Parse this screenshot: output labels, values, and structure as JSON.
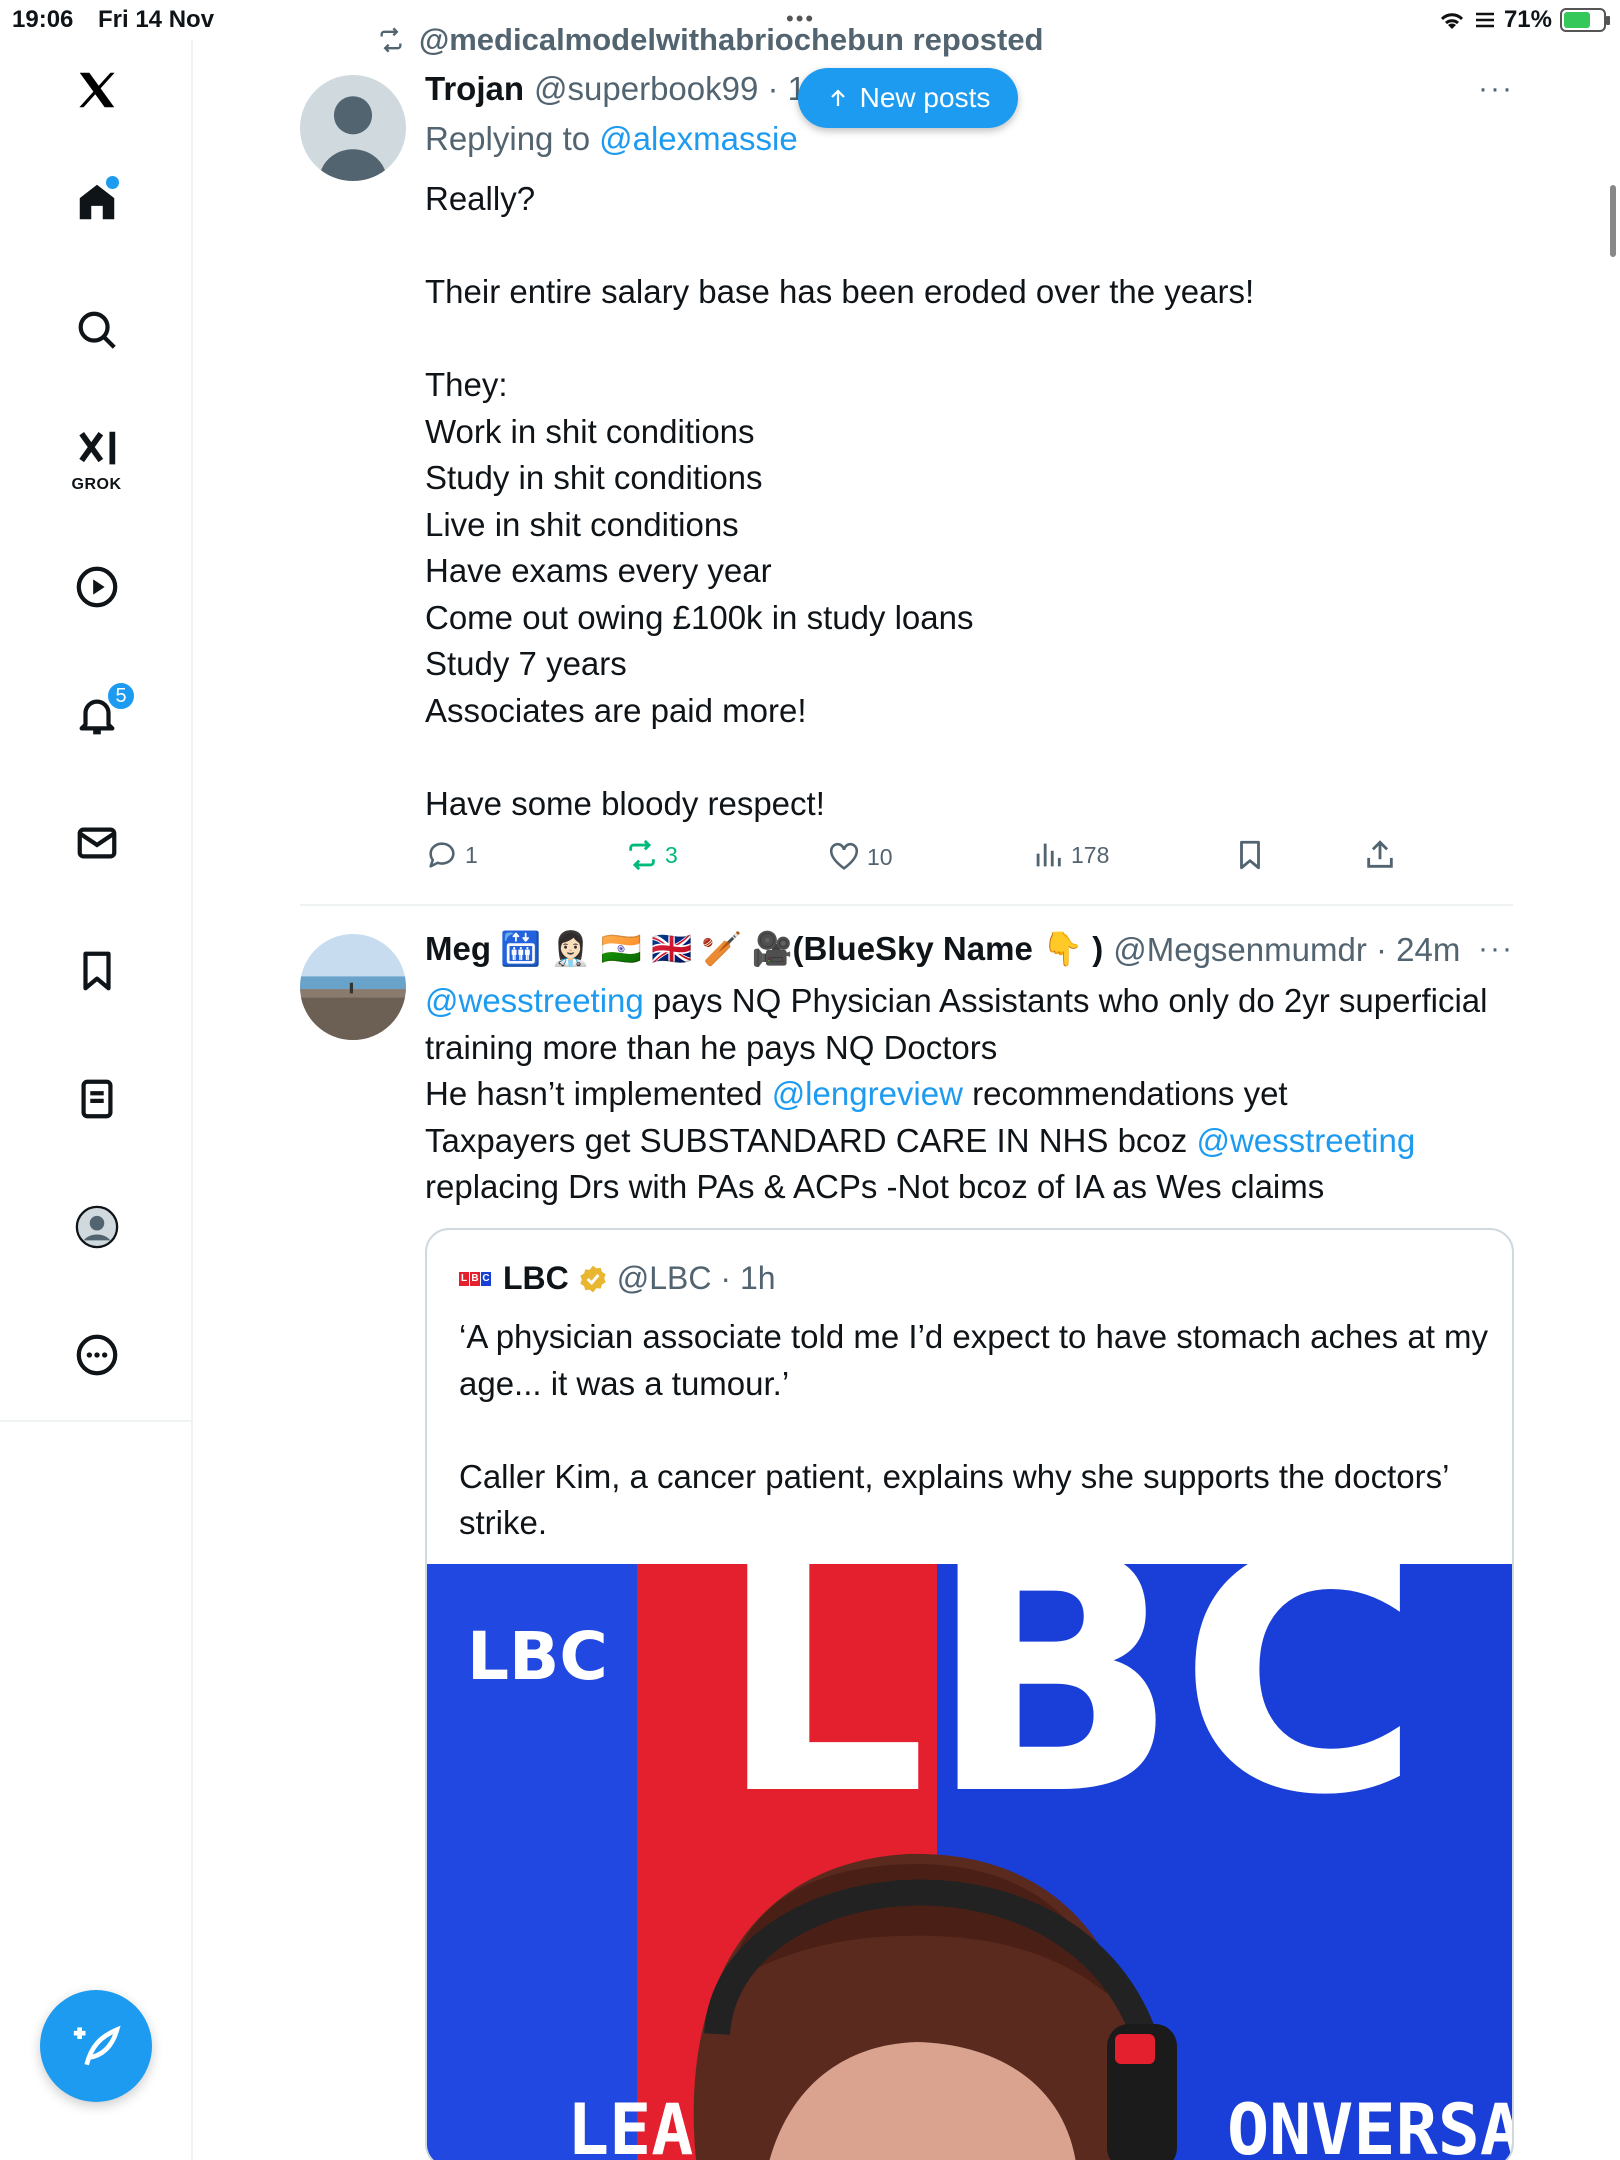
{
  "status_bar": {
    "time": "19:06",
    "date": "Fri 14 Nov",
    "battery": "71%",
    "battery_level": 0.71
  },
  "sidebar": {
    "items": [
      {
        "name": "x-logo"
      },
      {
        "name": "home",
        "has_dot": true
      },
      {
        "name": "search"
      },
      {
        "name": "grok",
        "label": "GROK"
      },
      {
        "name": "video"
      },
      {
        "name": "notifications",
        "badge": "5"
      },
      {
        "name": "messages"
      },
      {
        "name": "bookmarks"
      },
      {
        "name": "lists"
      },
      {
        "name": "profile"
      },
      {
        "name": "more"
      }
    ]
  },
  "new_posts_label": "New posts",
  "tweet1": {
    "repost_by": "@medicalmodelwithabriochebun reposted",
    "name": "Trojan",
    "handle": "@superbook99 · 1",
    "replying_label": "Replying to",
    "replying_to": "@alexmassie",
    "text": "Really?\n\nTheir entire salary base has been eroded over the years!\n\nThey:\nWork in shit conditions\nStudy in shit conditions\nLive in shit conditions\nHave exams every year\nCome out owing £100k in study loans\nStudy 7 years\nAssociates are paid more!\n\nHave some bloody respect!",
    "replies": "1",
    "reposts": "3",
    "likes": "10",
    "views": "178"
  },
  "tweet2": {
    "name": "Meg 🛗 👩🏻‍⚕️ 🇮🇳 🇬🇧 🏏 🎥(BlueSky Name 👇 )",
    "handle": "@Megsenmumdr · 24m",
    "text_parts": {
      "m1": "@wesstreeting",
      "t1": " pays NQ Physician Assistants who only do 2yr superficial training more than he pays NQ Doctors\nHe hasn’t implemented ",
      "m2": "@lengreview",
      "t2": " recommendations yet\nTaxpayers get SUBSTANDARD CARE IN NHS bcoz ",
      "m3": "@wesstreeting",
      "t3": "\nreplacing Drs with PAs & ACPs -Not bcoz of IA as Wes claims"
    },
    "quote": {
      "logo_text": "LBC",
      "name": "LBC",
      "handle": "@LBC · 1h",
      "text": "‘A physician associate told me I’d expect to have stomach aches at my age... it was a tumour.’\n\nCaller Kim, a cancer patient, explains why she supports the doctors’ strike.",
      "media_logo": "LBC",
      "media_big_letters": "LBC",
      "media_bottom_left": "LEA",
      "media_bottom_right": "ONVERSA"
    }
  },
  "colors": {
    "accent": "#1d9bf0",
    "repost_green": "#00ba7c",
    "muted": "#536471",
    "lbc_red": "#e4202e",
    "lbc_blue": "#1a3fd8"
  }
}
